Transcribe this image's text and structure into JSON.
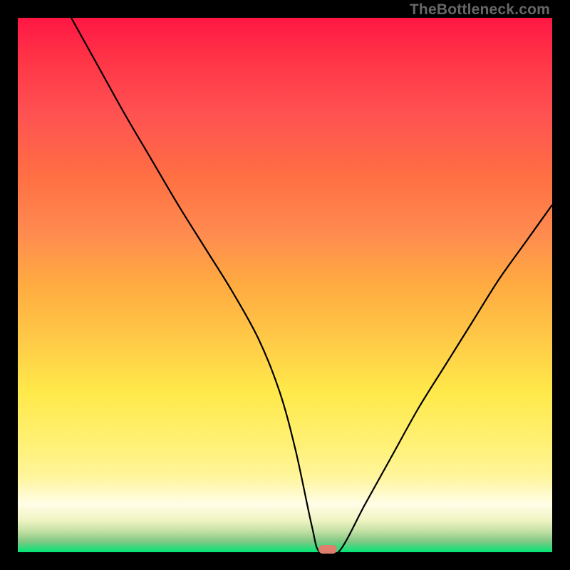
{
  "watermark": "TheBottleneck.com",
  "chart_data": {
    "type": "line",
    "title": "",
    "xlabel": "",
    "ylabel": "",
    "x_range": [
      0,
      100
    ],
    "y_range": [
      0,
      100
    ],
    "series": [
      {
        "name": "bottleneck-curve",
        "x": [
          10,
          15,
          20,
          25,
          30,
          35,
          40,
          45,
          49,
          52,
          55,
          56.5,
          60,
          65,
          70,
          75,
          80,
          85,
          90,
          95,
          100
        ],
        "y": [
          100,
          91,
          82,
          73.5,
          65,
          57,
          49,
          40,
          30,
          19,
          5,
          0,
          0,
          9,
          18,
          27,
          35,
          43,
          51,
          58,
          65
        ]
      }
    ],
    "marker": {
      "x": 58,
      "y": 0,
      "color": "#e07f6e"
    },
    "grid": false,
    "legend": false
  }
}
